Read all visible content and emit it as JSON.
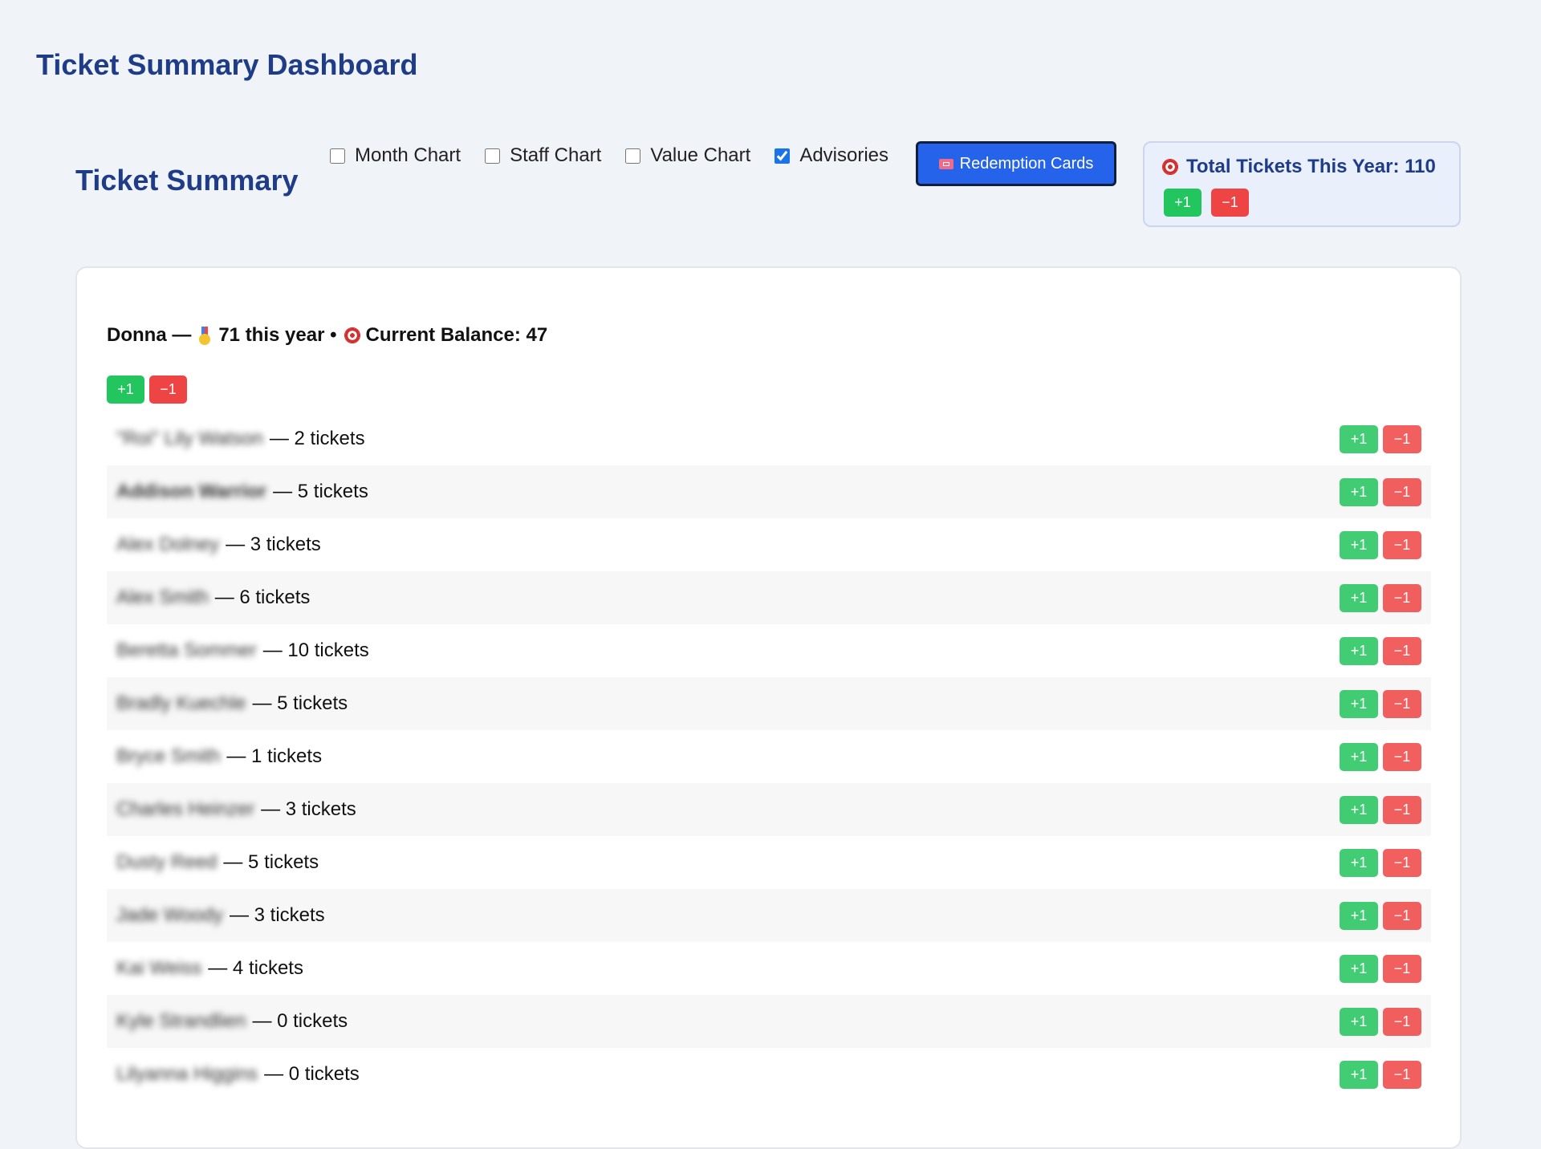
{
  "page": {
    "title": "Ticket Summary Dashboard"
  },
  "header": {
    "section_title": "Ticket Summary",
    "toggles": [
      {
        "label": "Month Chart",
        "checked": false
      },
      {
        "label": "Staff Chart",
        "checked": false
      },
      {
        "label": "Value Chart",
        "checked": false
      },
      {
        "label": "Advisories",
        "checked": true
      }
    ],
    "redemption_button": "Redemption Cards",
    "total": {
      "label": "Total Tickets This Year: 110",
      "plus": "+1",
      "minus": "−1"
    }
  },
  "staff": {
    "name": "Donna —",
    "year_text": "71 this year •",
    "balance_text": "Current Balance: 47",
    "plus": "+1",
    "minus": "−1"
  },
  "rows": [
    {
      "name": "\"Roi\" Lily Watson",
      "count": "— 2 tickets",
      "bold": false
    },
    {
      "name": "Addison Warrior",
      "count": "— 5 tickets",
      "bold": true
    },
    {
      "name": "Alex Dolney",
      "count": "— 3 tickets",
      "bold": false
    },
    {
      "name": "Alex Smith",
      "count": "— 6 tickets",
      "bold": false
    },
    {
      "name": "Beretta Sommer",
      "count": "— 10 tickets",
      "bold": false
    },
    {
      "name": "Bradly Kuechle",
      "count": "— 5 tickets",
      "bold": false
    },
    {
      "name": "Bryce Smith",
      "count": "— 1 tickets",
      "bold": false
    },
    {
      "name": "Charles Heinzer",
      "count": "— 3 tickets",
      "bold": false
    },
    {
      "name": "Dusty Reed",
      "count": "— 5 tickets",
      "bold": false
    },
    {
      "name": "Jade Woody",
      "count": "— 3 tickets",
      "bold": false
    },
    {
      "name": "Kai Weiss",
      "count": "— 4 tickets",
      "bold": false
    },
    {
      "name": "Kyle Strandlien",
      "count": "— 0 tickets",
      "bold": false
    },
    {
      "name": "Lilyanna Higgins",
      "count": "— 0 tickets",
      "bold": false
    }
  ],
  "row_buttons": {
    "plus": "+1",
    "minus": "−1"
  },
  "colors": {
    "accent": "#1f3c88",
    "primary_button": "#2563eb",
    "plus": "#22c55e",
    "minus": "#ef4444"
  },
  "icons": {
    "ticket": "ticket-icon",
    "target": "target-icon",
    "medal": "medal-icon"
  }
}
